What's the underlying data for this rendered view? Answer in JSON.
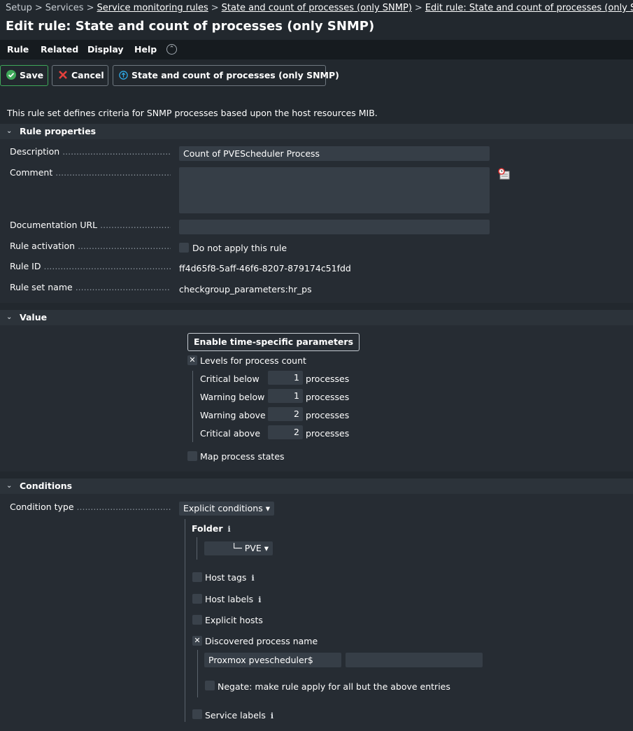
{
  "breadcrumb": {
    "items": [
      "Setup",
      "Services",
      "Service monitoring rules",
      "State and count of processes (only SNMP)",
      "Edit rule: State and count of processes (only SNMP)"
    ],
    "separator": ">"
  },
  "page_title": "Edit rule: State and count of processes (only SNMP)",
  "menu": {
    "items": [
      "Rule",
      "Related",
      "Display",
      "Help"
    ],
    "toggle_icon": "chevron-up-icon"
  },
  "toolbar": {
    "save_label": "Save",
    "cancel_label": "Cancel",
    "ruleset_label": "State and count of processes (only SNMP)"
  },
  "info_text": "This rule set defines criteria for SNMP processes based upon the host resources MIB.",
  "rule_properties": {
    "header": "Rule properties",
    "description_label": "Description",
    "description_value": "Count of PVEScheduler Process",
    "comment_label": "Comment",
    "comment_value": "",
    "doc_url_label": "Documentation URL",
    "doc_url_value": "",
    "activation_label": "Rule activation",
    "activation_checkbox_label": "Do not apply this rule",
    "rule_id_label": "Rule ID",
    "rule_id_value": "ff4d65f8-5aff-46f6-8207-879174c51fdd",
    "ruleset_name_label": "Rule set name",
    "ruleset_name_value": "checkgroup_parameters:hr_ps"
  },
  "value": {
    "header": "Value",
    "time_specific_button": "Enable time-specific parameters",
    "levels_label": "Levels for process count",
    "levels_checked": true,
    "levels": [
      {
        "label": "Critical below",
        "value": "1",
        "unit": "processes"
      },
      {
        "label": "Warning below",
        "value": "1",
        "unit": "processes"
      },
      {
        "label": "Warning above",
        "value": "2",
        "unit": "processes"
      },
      {
        "label": "Critical above",
        "value": "2",
        "unit": "processes"
      }
    ],
    "map_states_label": "Map process states"
  },
  "conditions": {
    "header": "Conditions",
    "condition_type_label": "Condition type",
    "condition_type_value": "Explicit conditions",
    "folder_label": "Folder",
    "folder_value": "└─ PVE",
    "host_tags_label": "Host tags",
    "host_labels_label": "Host labels",
    "explicit_hosts_label": "Explicit hosts",
    "discovered_label": "Discovered process name",
    "discovered_checked": true,
    "discovered_value": "Proxmox pvescheduler$",
    "discovered_value2": "",
    "negate_label": "Negate: make rule apply for all but the above entries",
    "service_labels_label": "Service labels"
  },
  "colors": {
    "background": "#22282e",
    "section_header": "#2c333a",
    "input": "#363e47",
    "save_accent": "#3fa85a",
    "cancel_accent": "#e5413d",
    "link_accent": "#2ea8e5"
  }
}
